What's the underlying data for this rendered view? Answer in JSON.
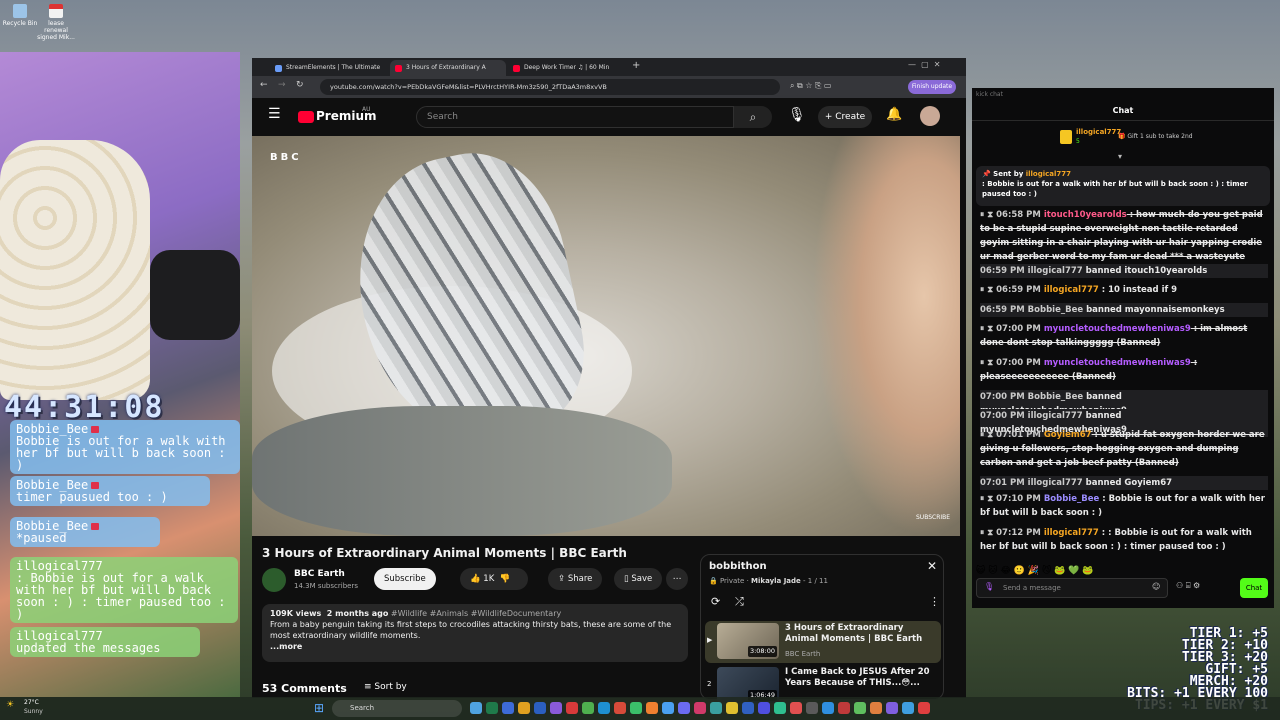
{
  "desktop": {
    "icons": [
      {
        "label": "Recycle Bin"
      },
      {
        "label": "lease renewal signed Mik..."
      }
    ]
  },
  "stream_overlay": {
    "timer": "44:31:08",
    "messages": [
      {
        "user": "Bobbie_Bee",
        "text": "Bobbie is out for a walk with her bf but will b back soon : )",
        "style": "blue"
      },
      {
        "user": "Bobbie_Bee",
        "text": "timer pausued too : )",
        "style": "blue"
      },
      {
        "user": "Bobbie_Bee",
        "text": "*paused",
        "style": "blue"
      },
      {
        "user": "illogical777",
        "text": ": Bobbie is out for a walk with her bf but will b back soon : ) : timer paused too : )",
        "style": "green"
      },
      {
        "user": "illogical777",
        "text": "updated the messages",
        "style": "green"
      }
    ],
    "tiers": [
      "TIER 1: +5",
      "TIER 2: +10",
      "TIER 3: +20",
      "GIFT: +5",
      "MERCH: +20",
      "BITS: +1 EVERY 100",
      "TIPS: +1 EVERY $1"
    ]
  },
  "browser": {
    "tabs": [
      {
        "title": "StreamElements | The Ultimate",
        "color": "#6a9cf7"
      },
      {
        "title": "3 Hours of Extraordinary A",
        "color": "#ff0033"
      },
      {
        "title": "Deep Work Timer ♫ | 60 Min",
        "color": "#ff0033"
      }
    ],
    "url": "youtube.com/watch?v=PEbDkaVGFeM&list=PLVHrctHYIR-Mm3z590_2fTDaA3m8xvVB",
    "finish_update": "Finish update"
  },
  "youtube": {
    "logo": "Premium",
    "region": "AU",
    "search_placeholder": "Search",
    "create": "Create",
    "bbc_tag": "BBC",
    "subscribe_tag": "SUBSCRIBE",
    "video_title": "3 Hours of Extraordinary Animal Moments | BBC Earth",
    "channel": "BBC Earth",
    "subscribers": "14.3M subscribers",
    "subscribe": "Subscribe",
    "likes": "1K",
    "share": "Share",
    "save": "Save",
    "views": "109K views",
    "age": "2 months ago",
    "tags": "#Wildlife #Animals #WildlifeDocumentary",
    "description": "From a baby penguin taking its first steps to crocodiles attacking thirsty bats, these are some of the most extraordinary wildlife moments.",
    "more": "...more",
    "comments": "53 Comments",
    "sort_by": "Sort by",
    "playlist": {
      "title": "bobbithon",
      "meta": "Private",
      "owner": "Mikayla Jade",
      "position": "1 / 11",
      "items": [
        {
          "index": "▶",
          "title": "3 Hours of Extraordinary Animal Moments | BBC Earth",
          "channel": "BBC Earth",
          "duration": "3:08:00"
        },
        {
          "index": "2",
          "title": "I Came Back to JESUS After 20 Years Because of THIS...😳...",
          "channel": "",
          "duration": "1:06:49"
        }
      ]
    }
  },
  "chat": {
    "window_title": "kick chat",
    "header": "Chat",
    "gifter": {
      "name": "illogical777",
      "count": "5",
      "note": "Gift 1 sub to take 2nd"
    },
    "pinned": {
      "sent_by": "Sent by",
      "user": "illogical777",
      "text": ": Bobbie is out for a walk with her bf but will b back soon : ) : timer paused too : )"
    },
    "messages": [
      {
        "time": "06:58 PM",
        "user": "itouch10yearolds",
        "text": ": how much do you get paid to be a stupid supine overweight non tactile retarded goyim sitting in a chair playing with ur hair yapping crodie ur mad gerber word to my fam ur dead *** a wasteyute (Banned)",
        "color": "#ff5a8a",
        "struck": true
      },
      {
        "time": "06:59 PM",
        "user": "illogical777",
        "text": "banned itouch10yearolds",
        "system": true
      },
      {
        "time": "06:59 PM",
        "user": "illogical777",
        "text": ": 10 instead if 9",
        "color": "#f5a623",
        "struck": false
      },
      {
        "time": "06:59 PM",
        "user": "Bobbie_Bee",
        "text": "banned mayonnaisemonkeys",
        "system": true
      },
      {
        "time": "07:00 PM",
        "user": "myuncletouchedmewheniwas9",
        "text": ": im almost done dont stop talkinggggg (Banned)",
        "color": "#b45cff",
        "struck": true
      },
      {
        "time": "07:00 PM",
        "user": "myuncletouchedmewheniwas9",
        "text": ": pleaseeeeeeeeeee (Banned)",
        "color": "#b45cff",
        "struck": true
      },
      {
        "time": "07:00 PM",
        "user": "Bobbie_Bee",
        "text": "banned myuncletouchedmewheniwas9",
        "system": true
      },
      {
        "time": "07:00 PM",
        "user": "illogical777",
        "text": "banned myuncletouchedmewheniwas9",
        "system": true
      },
      {
        "time": "07:01 PM",
        "user": "Goyiem67",
        "text": ": u stupid fat oxygen horder we are giving u followers, stop hogging oxygen and dumping carbon and get a job beef patty (Banned)",
        "color": "#f5a623",
        "struck": true
      },
      {
        "time": "07:01 PM",
        "user": "illogical777",
        "text": "banned Goyiem67",
        "system": true
      },
      {
        "time": "07:10 PM",
        "user": "Bobbie_Bee",
        "text": ": Bobbie is out for a walk with her bf but will b back soon : )",
        "color": "#9b8cff",
        "struck": false
      },
      {
        "time": "07:12 PM",
        "user": "illogical777",
        "text": ": : Bobbie is out for a walk with her bf but will b back soon : ) : timer paused too : )",
        "color": "#f5a623",
        "struck": false
      }
    ],
    "input_placeholder": "Send a message",
    "send": "Chat"
  },
  "taskbar": {
    "weather_temp": "27°C",
    "weather_desc": "Sunny",
    "search_placeholder": "Search"
  }
}
